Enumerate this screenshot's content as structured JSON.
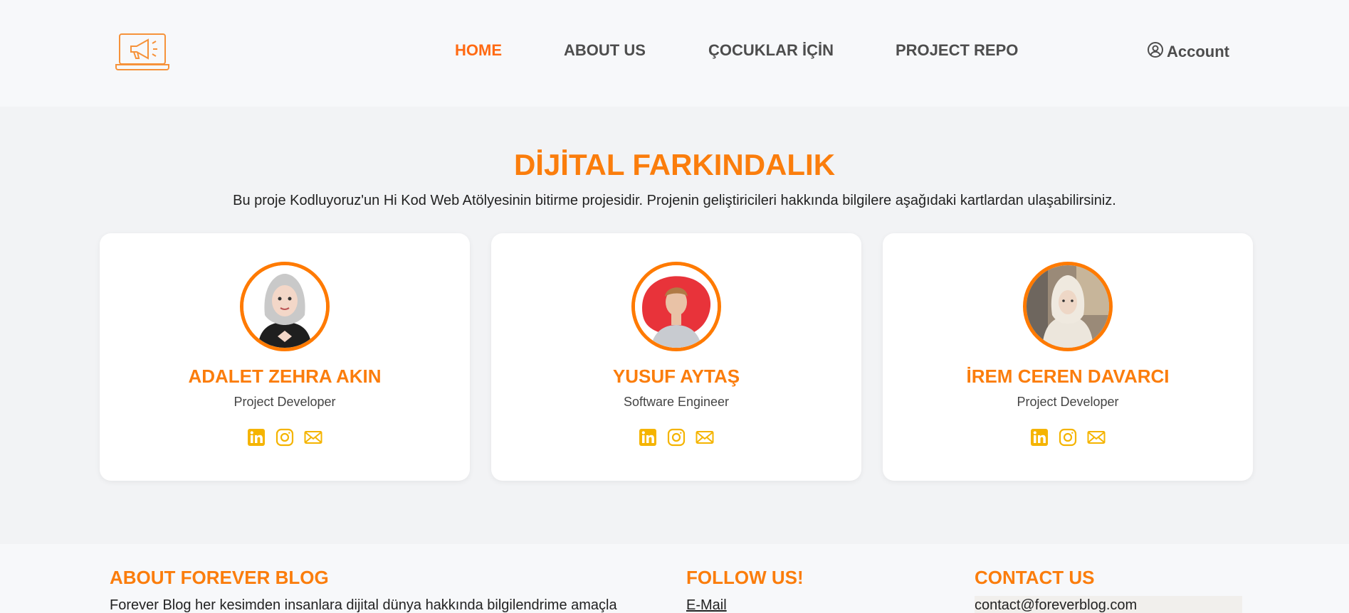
{
  "nav": {
    "items": [
      "HOME",
      "ABOUT US",
      "ÇOCUKLAR İÇİN",
      "PROJECT REPO"
    ],
    "active_index": 0,
    "account_label": "Account"
  },
  "hero": {
    "title": "DİJİTAL FARKINDALIK",
    "description": "Bu proje Kodluyoruz'un Hi Kod Web Atölyesinin bitirme projesidir. Projenin geliştiricileri hakkında bilgilere aşağıdaki kartlardan ulaşabilirsiniz."
  },
  "team": [
    {
      "name": "ADALET ZEHRA AKIN",
      "role": "Project Developer"
    },
    {
      "name": "YUSUF AYTAŞ",
      "role": "Software Engineer"
    },
    {
      "name": "İREM CEREN DAVARCI",
      "role": "Project Developer"
    }
  ],
  "footer": {
    "about_title": "ABOUT FOREVER BLOG",
    "about_text": "Forever Blog her kesimden insanlara dijital dünya hakkında bilgilendrime amaçla",
    "follow_title": "FOLLOW US!",
    "follow_link": "E-Mail",
    "contact_title": "CONTACT US",
    "contact_email": "contact@foreverblog.com"
  },
  "colors": {
    "accent": "#fb7d0c",
    "nav_active": "#ff6a13",
    "social_icon": "#f5b400"
  }
}
